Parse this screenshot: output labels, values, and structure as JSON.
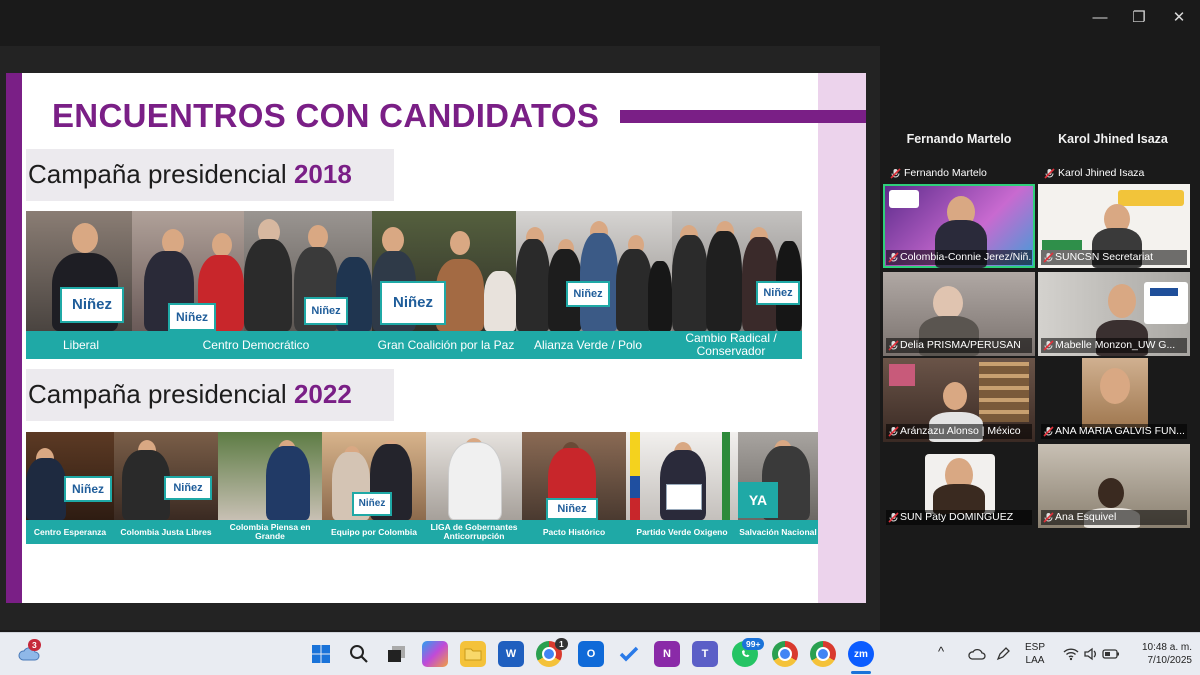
{
  "window": {
    "minimize": "—",
    "restore": "❐",
    "close": "✕"
  },
  "slide": {
    "title": "ENCUENTROS CON CANDIDATOS",
    "campaign_2018": {
      "prefix": "Campaña presidencial ",
      "year": "2018"
    },
    "campaign_2022": {
      "prefix": "Campaña presidencial ",
      "year": "2022"
    },
    "box_text": "Niñez",
    "box_text_ya": "YA",
    "labels_2018": [
      "Liberal",
      "Centro Democrático",
      "Gran Coalición por la Paz",
      "Alianza Verde / Polo",
      "Cambio Radical / Conservador"
    ],
    "labels_2022": [
      "Centro Esperanza",
      "Colombia Justa Libres",
      "Colombia Piensa en Grande",
      "Equipo por Colombia",
      "LIGA de Gobernantes Anticorrupción",
      "Pacto Histórico",
      "Partido Verde Oxigeno",
      "Salvación Nacional"
    ]
  },
  "participants": {
    "header_names": [
      "Fernando Martelo",
      "Karol Jhined Isaza"
    ],
    "mini_labels": [
      "Fernando Martelo",
      "Karol Jhined Isaza"
    ],
    "tiles": [
      "Colombia-Connie Jerez/Niñ...",
      "SUNCSN Secretariat",
      "Delia PRISMA/PERUSAN",
      "Mabelle Monzon_UW G...",
      "Aránzazu Alonso | México",
      "ANA MARIA GALVIS FUN...",
      "SUN Paty DOMINGUEZ",
      "Ana Esquivel"
    ]
  },
  "taskbar": {
    "weather_badge": "3",
    "whatsapp_badge": "99+",
    "chrome_badge": "1",
    "zoom_label": "zm",
    "language": "ESP",
    "language_sub": "LAA",
    "time": "10:48 a. m.",
    "date": "7/10/2025",
    "caret": "^"
  }
}
